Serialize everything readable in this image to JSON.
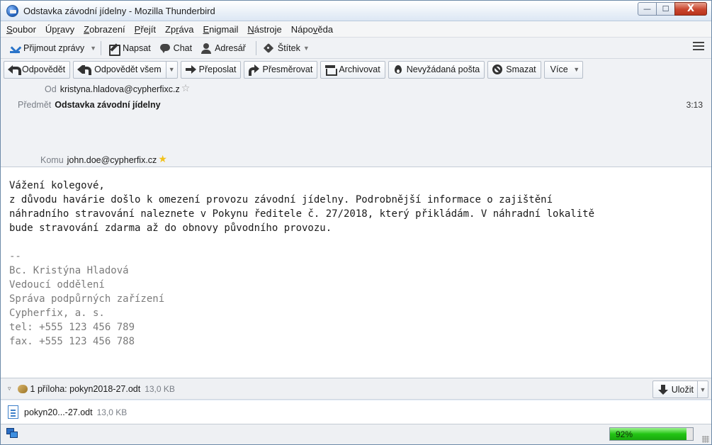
{
  "window": {
    "title": "Odstavka závodní jídelny - Mozilla Thunderbird",
    "minimize_glyph": "—",
    "maximize_glyph": "☐",
    "close_glyph": "X"
  },
  "menubar": {
    "items": [
      {
        "u": "S",
        "rest": "oubor"
      },
      {
        "pre": "Úp",
        "u": "r",
        "rest": "avy"
      },
      {
        "u": "Z",
        "rest": "obrazení"
      },
      {
        "u": "P",
        "rest": "řejít"
      },
      {
        "pre": "Zp",
        "u": "r",
        "rest": "áva"
      },
      {
        "u": "E",
        "rest": "nigmail"
      },
      {
        "u": "N",
        "rest": "ástroje"
      },
      {
        "pre": "Nápo",
        "u": "v",
        "rest": "ěda"
      }
    ]
  },
  "toolbar": {
    "get_mail": "Přijmout zprávy",
    "write": "Napsat",
    "chat": "Chat",
    "address_book": "Adresář",
    "tag": "Štítek",
    "dropdown_glyph": "▼"
  },
  "header_toolbar": {
    "reply": "Odpovědět",
    "reply_all": "Odpovědět všem",
    "forward": "Přeposlat",
    "redirect": "Přesměrovat",
    "archive": "Archivovat",
    "junk": "Nevyžádaná pošta",
    "delete": "Smazat",
    "more": "Více"
  },
  "headers": {
    "from_label": "Od",
    "from_value": "kristyna.hladova@cypherfixc.z",
    "subject_label": "Předmět",
    "subject_value": "Odstavka závodní jídelny",
    "time": "3:13",
    "to_label": "Komu",
    "to_value": "john.doe@cypherfix.cz"
  },
  "body": {
    "greeting": "Vážení kolegové,",
    "lines": [
      "z důvodu havárie došlo k omezení provozu závodní jídelny. Podrobnější informace o zajištění",
      "náhradního stravování naleznete v Pokynu ředitele č. 27/2018, který přikládám. V náhradní lokalitě",
      "bude stravování zdarma až do obnovy původního provozu."
    ],
    "signature": [
      "--",
      "Bc. Kristýna Hladová",
      "Vedoucí oddělení",
      "Správa podpůrných zařízení",
      "Cypherfix, a. s.",
      "tel: +555 123 456 789",
      "fax. +555 123 456 788"
    ]
  },
  "attachments": {
    "twisty_glyph": "▿",
    "summary": "1 příloha: pokyn2018-27.odt",
    "summary_size": "13,0 KB",
    "save_label": "Uložit",
    "items": [
      {
        "name": "pokyn20...-27.odt",
        "size": "13,0 KB"
      }
    ]
  },
  "status": {
    "progress_text": "92%",
    "progress_value": 0.92
  },
  "colors": {
    "progress_green": "#22c414",
    "close_red": "#c9452e"
  }
}
